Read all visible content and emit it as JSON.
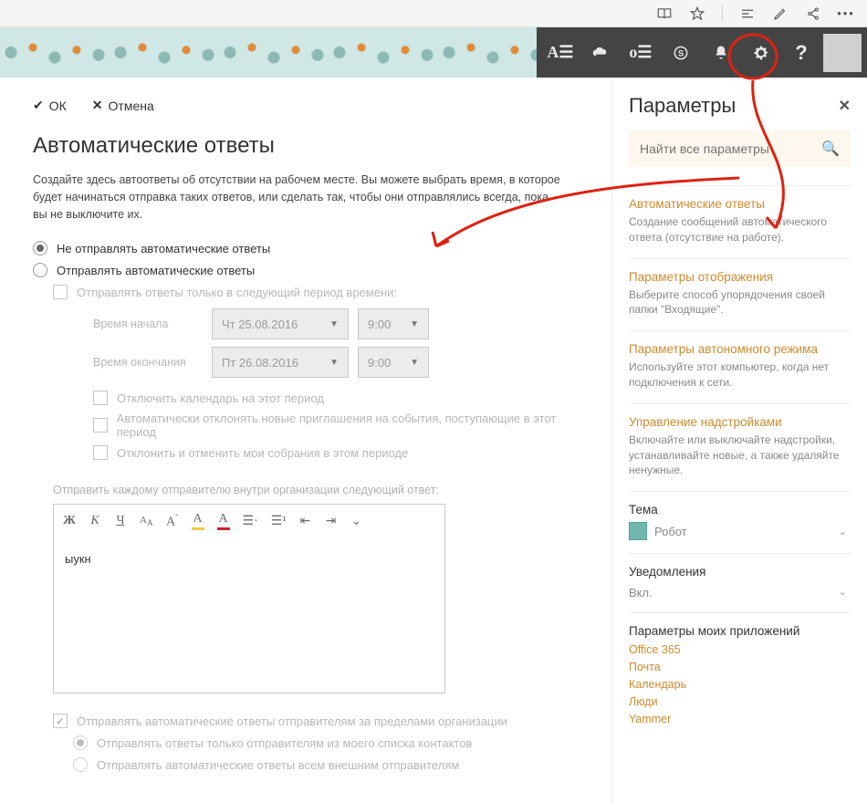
{
  "browser": {
    "icons": [
      "book",
      "star",
      "sep",
      "lines",
      "pencil",
      "share",
      "more"
    ]
  },
  "topbar": {
    "icons": [
      "ax",
      "cloud",
      "outlook",
      "skype",
      "bell",
      "gear",
      "help"
    ]
  },
  "actions": {
    "ok": "ОК",
    "cancel": "Отмена"
  },
  "page": {
    "title": "Автоматические ответы",
    "description": "Создайте здесь автоответы об отсутствии на рабочем месте. Вы можете выбрать время, в которое будет начинаться отправка таких ответов, или сделать так, чтобы они отправлялись всегда, пока вы не выключите их."
  },
  "radios": {
    "dont_send": "Не отправлять автоматические ответы",
    "send": "Отправлять автоматические ответы"
  },
  "period": {
    "only_period": "Отправлять ответы только в следующий период времени:",
    "start_label": "Время начала",
    "start_date": "Чт 25.08.2016",
    "start_time": "9:00",
    "end_label": "Время окончания",
    "end_date": "Пт 26.08.2016",
    "end_time": "9:00"
  },
  "options": {
    "block_calendar": "Отключить календарь на этот период",
    "decline_new": "Автоматически отклонять новые приглашения на события, поступающие в этот период",
    "cancel_meetings": "Отклонить и отменить мои собрания в этом периоде"
  },
  "message": {
    "label": "Отправить каждому отправителю внутри организации следующий ответ:",
    "body": "ыукн"
  },
  "outside": {
    "send_outside": "Отправлять автоматические ответы отправителям за пределами организации",
    "contacts_only": "Отправлять ответы только отправителям из моего списка контактов",
    "all_external": "Отправлять автоматические ответы всем внешним отправителям"
  },
  "sidepanel": {
    "title": "Параметры",
    "search_placeholder": "Найти все параметры",
    "sections": {
      "autoreply": {
        "title": "Автоматические ответы",
        "sub": "Создание сообщений автоматического ответа (отсутствие на работе)."
      },
      "display": {
        "title": "Параметры отображения",
        "sub": "Выберите способ упорядочения своей папки \"Входящие\"."
      },
      "offline": {
        "title": "Параметры автономного режима",
        "sub": "Используйте этот компьютер, когда нет подключения к сети."
      },
      "addins": {
        "title": "Управление надстройками",
        "sub": "Включайте или выключайте надстройки, устанавливайте новые, а также удаляйте ненужные."
      }
    },
    "theme": {
      "label": "Тема",
      "value": "Робот"
    },
    "notifications": {
      "label": "Уведомления",
      "value": "Вкл."
    },
    "apps_heading": "Параметры моих приложений",
    "apps": [
      "Office 365",
      "Почта",
      "Календарь",
      "Люди",
      "Yammer"
    ]
  }
}
